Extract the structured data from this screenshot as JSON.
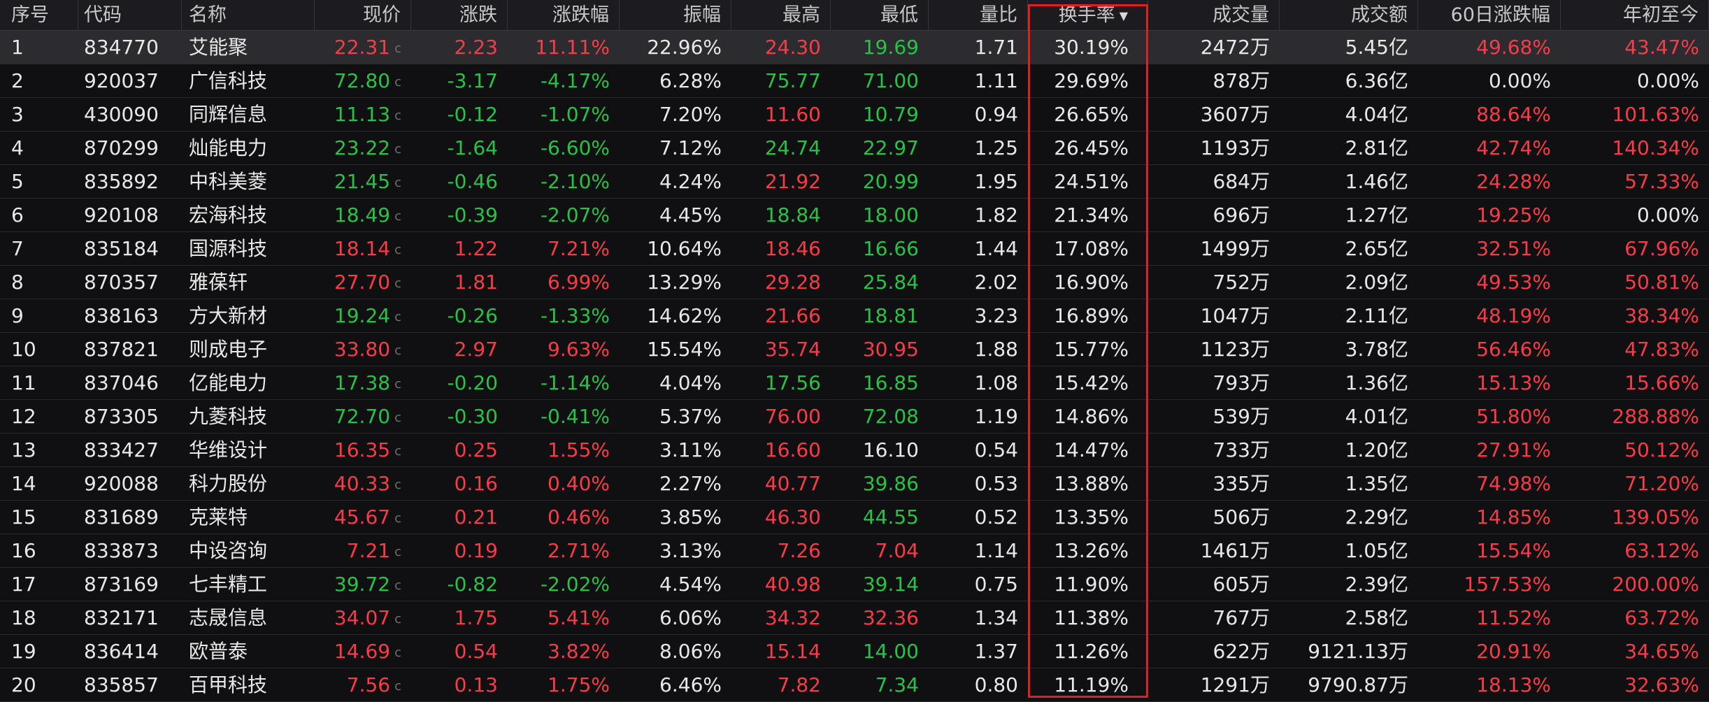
{
  "header": {
    "idx": "序号",
    "code": "代码",
    "name": "名称",
    "price": "现价",
    "change": "涨跌",
    "change_pct": "涨跌幅",
    "amplitude": "振幅",
    "high": "最高",
    "low": "最低",
    "volume_ratio": "量比",
    "turnover": "换手率",
    "volume": "成交量",
    "amount": "成交额",
    "chg_60d": "60日涨跌幅",
    "ytd": "年初至今"
  },
  "sort_indicator_icon": "sort-down-triangle",
  "price_suffix": "c",
  "colors": {
    "up": "#ff3b48",
    "down": "#27c346",
    "flat": "#e8e8e8",
    "highlight_border": "#e02020",
    "background": "#101012"
  },
  "rows": [
    {
      "idx": "1",
      "code": "834770",
      "name": "艾能聚",
      "price": "22.31",
      "change": "2.23",
      "change_pct": "11.11%",
      "amplitude": "22.96%",
      "high": "24.30",
      "low": "19.69",
      "volume_ratio": "1.71",
      "turnover": "30.19%",
      "volume": "2472万",
      "amount": "5.45亿",
      "chg_60d": "49.68%",
      "ytd": "43.47%",
      "c_price": "red",
      "c_change": "red",
      "c_high": "red",
      "c_low": "green",
      "c_d60": "red",
      "c_ytd": "red",
      "selected": true
    },
    {
      "idx": "2",
      "code": "920037",
      "name": "广信科技",
      "price": "72.80",
      "change": "-3.17",
      "change_pct": "-4.17%",
      "amplitude": "6.28%",
      "high": "75.77",
      "low": "71.00",
      "volume_ratio": "1.11",
      "turnover": "29.69%",
      "volume": "878万",
      "amount": "6.36亿",
      "chg_60d": "0.00%",
      "ytd": "0.00%",
      "c_price": "green",
      "c_change": "green",
      "c_high": "green",
      "c_low": "green",
      "c_d60": "white",
      "c_ytd": "white"
    },
    {
      "idx": "3",
      "code": "430090",
      "name": "同辉信息",
      "price": "11.13",
      "change": "-0.12",
      "change_pct": "-1.07%",
      "amplitude": "7.20%",
      "high": "11.60",
      "low": "10.79",
      "volume_ratio": "0.94",
      "turnover": "26.65%",
      "volume": "3607万",
      "amount": "4.04亿",
      "chg_60d": "88.64%",
      "ytd": "101.63%",
      "c_price": "green",
      "c_change": "green",
      "c_high": "red",
      "c_low": "green",
      "c_d60": "red",
      "c_ytd": "red"
    },
    {
      "idx": "4",
      "code": "870299",
      "name": "灿能电力",
      "price": "23.22",
      "change": "-1.64",
      "change_pct": "-6.60%",
      "amplitude": "7.12%",
      "high": "24.74",
      "low": "22.97",
      "volume_ratio": "1.25",
      "turnover": "26.45%",
      "volume": "1193万",
      "amount": "2.81亿",
      "chg_60d": "42.74%",
      "ytd": "140.34%",
      "c_price": "green",
      "c_change": "green",
      "c_high": "green",
      "c_low": "green",
      "c_d60": "red",
      "c_ytd": "red"
    },
    {
      "idx": "5",
      "code": "835892",
      "name": "中科美菱",
      "price": "21.45",
      "change": "-0.46",
      "change_pct": "-2.10%",
      "amplitude": "4.24%",
      "high": "21.92",
      "low": "20.99",
      "volume_ratio": "1.95",
      "turnover": "24.51%",
      "volume": "684万",
      "amount": "1.46亿",
      "chg_60d": "24.28%",
      "ytd": "57.33%",
      "c_price": "green",
      "c_change": "green",
      "c_high": "red",
      "c_low": "green",
      "c_d60": "red",
      "c_ytd": "red"
    },
    {
      "idx": "6",
      "code": "920108",
      "name": "宏海科技",
      "price": "18.49",
      "change": "-0.39",
      "change_pct": "-2.07%",
      "amplitude": "4.45%",
      "high": "18.84",
      "low": "18.00",
      "volume_ratio": "1.82",
      "turnover": "21.34%",
      "volume": "696万",
      "amount": "1.27亿",
      "chg_60d": "19.25%",
      "ytd": "0.00%",
      "c_price": "green",
      "c_change": "green",
      "c_high": "green",
      "c_low": "green",
      "c_d60": "red",
      "c_ytd": "white"
    },
    {
      "idx": "7",
      "code": "835184",
      "name": "国源科技",
      "price": "18.14",
      "change": "1.22",
      "change_pct": "7.21%",
      "amplitude": "10.64%",
      "high": "18.46",
      "low": "16.66",
      "volume_ratio": "1.44",
      "turnover": "17.08%",
      "volume": "1499万",
      "amount": "2.65亿",
      "chg_60d": "32.51%",
      "ytd": "67.96%",
      "c_price": "red",
      "c_change": "red",
      "c_high": "red",
      "c_low": "green",
      "c_d60": "red",
      "c_ytd": "red"
    },
    {
      "idx": "8",
      "code": "870357",
      "name": "雅葆轩",
      "price": "27.70",
      "change": "1.81",
      "change_pct": "6.99%",
      "amplitude": "13.29%",
      "high": "29.28",
      "low": "25.84",
      "volume_ratio": "2.02",
      "turnover": "16.90%",
      "volume": "752万",
      "amount": "2.09亿",
      "chg_60d": "49.53%",
      "ytd": "50.81%",
      "c_price": "red",
      "c_change": "red",
      "c_high": "red",
      "c_low": "green",
      "c_d60": "red",
      "c_ytd": "red"
    },
    {
      "idx": "9",
      "code": "838163",
      "name": "方大新材",
      "price": "19.24",
      "change": "-0.26",
      "change_pct": "-1.33%",
      "amplitude": "14.62%",
      "high": "21.66",
      "low": "18.81",
      "volume_ratio": "3.23",
      "turnover": "16.89%",
      "volume": "1047万",
      "amount": "2.11亿",
      "chg_60d": "48.19%",
      "ytd": "38.34%",
      "c_price": "green",
      "c_change": "green",
      "c_high": "red",
      "c_low": "green",
      "c_d60": "red",
      "c_ytd": "red"
    },
    {
      "idx": "10",
      "code": "837821",
      "name": "则成电子",
      "price": "33.80",
      "change": "2.97",
      "change_pct": "9.63%",
      "amplitude": "15.54%",
      "high": "35.74",
      "low": "30.95",
      "volume_ratio": "1.88",
      "turnover": "15.77%",
      "volume": "1123万",
      "amount": "3.78亿",
      "chg_60d": "56.46%",
      "ytd": "47.83%",
      "c_price": "red",
      "c_change": "red",
      "c_high": "red",
      "c_low": "red",
      "c_d60": "red",
      "c_ytd": "red"
    },
    {
      "idx": "11",
      "code": "837046",
      "name": "亿能电力",
      "price": "17.38",
      "change": "-0.20",
      "change_pct": "-1.14%",
      "amplitude": "4.04%",
      "high": "17.56",
      "low": "16.85",
      "volume_ratio": "1.08",
      "turnover": "15.42%",
      "volume": "793万",
      "amount": "1.36亿",
      "chg_60d": "15.13%",
      "ytd": "15.66%",
      "c_price": "green",
      "c_change": "green",
      "c_high": "green",
      "c_low": "green",
      "c_d60": "red",
      "c_ytd": "red"
    },
    {
      "idx": "12",
      "code": "873305",
      "name": "九菱科技",
      "price": "72.70",
      "change": "-0.30",
      "change_pct": "-0.41%",
      "amplitude": "5.37%",
      "high": "76.00",
      "low": "72.08",
      "volume_ratio": "1.19",
      "turnover": "14.86%",
      "volume": "539万",
      "amount": "4.01亿",
      "chg_60d": "51.80%",
      "ytd": "288.88%",
      "c_price": "green",
      "c_change": "green",
      "c_high": "red",
      "c_low": "green",
      "c_d60": "red",
      "c_ytd": "red"
    },
    {
      "idx": "13",
      "code": "833427",
      "name": "华维设计",
      "price": "16.35",
      "change": "0.25",
      "change_pct": "1.55%",
      "amplitude": "3.11%",
      "high": "16.60",
      "low": "16.10",
      "volume_ratio": "0.54",
      "turnover": "14.47%",
      "volume": "733万",
      "amount": "1.20亿",
      "chg_60d": "27.91%",
      "ytd": "50.12%",
      "c_price": "red",
      "c_change": "red",
      "c_high": "red",
      "c_low": "white",
      "c_d60": "red",
      "c_ytd": "red"
    },
    {
      "idx": "14",
      "code": "920088",
      "name": "科力股份",
      "price": "40.33",
      "change": "0.16",
      "change_pct": "0.40%",
      "amplitude": "2.27%",
      "high": "40.77",
      "low": "39.86",
      "volume_ratio": "0.53",
      "turnover": "13.88%",
      "volume": "335万",
      "amount": "1.35亿",
      "chg_60d": "74.98%",
      "ytd": "71.20%",
      "c_price": "red",
      "c_change": "red",
      "c_high": "red",
      "c_low": "green",
      "c_d60": "red",
      "c_ytd": "red"
    },
    {
      "idx": "15",
      "code": "831689",
      "name": "克莱特",
      "price": "45.67",
      "change": "0.21",
      "change_pct": "0.46%",
      "amplitude": "3.85%",
      "high": "46.30",
      "low": "44.55",
      "volume_ratio": "0.52",
      "turnover": "13.35%",
      "volume": "506万",
      "amount": "2.29亿",
      "chg_60d": "14.85%",
      "ytd": "139.05%",
      "c_price": "red",
      "c_change": "red",
      "c_high": "red",
      "c_low": "green",
      "c_d60": "red",
      "c_ytd": "red"
    },
    {
      "idx": "16",
      "code": "833873",
      "name": "中设咨询",
      "price": "7.21",
      "change": "0.19",
      "change_pct": "2.71%",
      "amplitude": "3.13%",
      "high": "7.26",
      "low": "7.04",
      "volume_ratio": "1.14",
      "turnover": "13.26%",
      "volume": "1461万",
      "amount": "1.05亿",
      "chg_60d": "15.54%",
      "ytd": "63.12%",
      "c_price": "red",
      "c_change": "red",
      "c_high": "red",
      "c_low": "red",
      "c_d60": "red",
      "c_ytd": "red"
    },
    {
      "idx": "17",
      "code": "873169",
      "name": "七丰精工",
      "price": "39.72",
      "change": "-0.82",
      "change_pct": "-2.02%",
      "amplitude": "4.54%",
      "high": "40.98",
      "low": "39.14",
      "volume_ratio": "0.75",
      "turnover": "11.90%",
      "volume": "605万",
      "amount": "2.39亿",
      "chg_60d": "157.53%",
      "ytd": "200.00%",
      "c_price": "green",
      "c_change": "green",
      "c_high": "red",
      "c_low": "green",
      "c_d60": "red",
      "c_ytd": "red"
    },
    {
      "idx": "18",
      "code": "832171",
      "name": "志晟信息",
      "price": "34.07",
      "change": "1.75",
      "change_pct": "5.41%",
      "amplitude": "6.06%",
      "high": "34.32",
      "low": "32.36",
      "volume_ratio": "1.34",
      "turnover": "11.38%",
      "volume": "767万",
      "amount": "2.58亿",
      "chg_60d": "11.52%",
      "ytd": "63.72%",
      "c_price": "red",
      "c_change": "red",
      "c_high": "red",
      "c_low": "red",
      "c_d60": "red",
      "c_ytd": "red"
    },
    {
      "idx": "19",
      "code": "836414",
      "name": "欧普泰",
      "price": "14.69",
      "change": "0.54",
      "change_pct": "3.82%",
      "amplitude": "8.06%",
      "high": "15.14",
      "low": "14.00",
      "volume_ratio": "1.37",
      "turnover": "11.26%",
      "volume": "622万",
      "amount": "9121.13万",
      "chg_60d": "20.91%",
      "ytd": "34.65%",
      "c_price": "red",
      "c_change": "red",
      "c_high": "red",
      "c_low": "green",
      "c_d60": "red",
      "c_ytd": "red"
    },
    {
      "idx": "20",
      "code": "835857",
      "name": "百甲科技",
      "price": "7.56",
      "change": "0.13",
      "change_pct": "1.75%",
      "amplitude": "6.46%",
      "high": "7.82",
      "low": "7.34",
      "volume_ratio": "0.80",
      "turnover": "11.19%",
      "volume": "1291万",
      "amount": "9790.87万",
      "chg_60d": "18.13%",
      "ytd": "32.63%",
      "c_price": "red",
      "c_change": "red",
      "c_high": "red",
      "c_low": "green",
      "c_d60": "red",
      "c_ytd": "red"
    }
  ]
}
